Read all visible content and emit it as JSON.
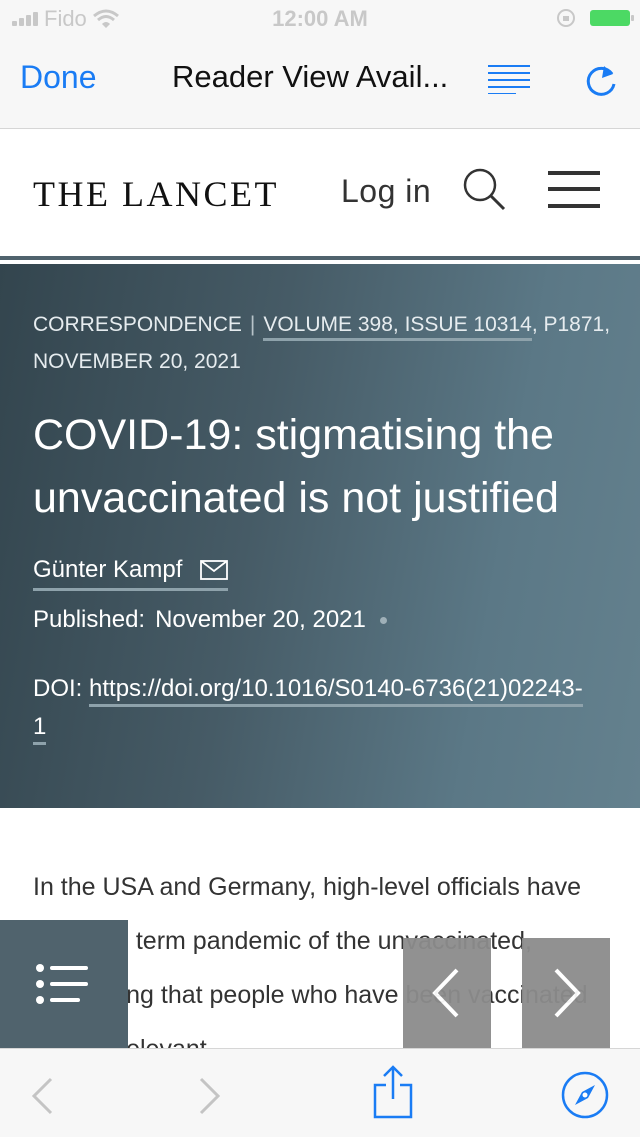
{
  "status_bar": {
    "carrier": "Fido",
    "time": "12:00 AM"
  },
  "safari": {
    "done_label": "Done",
    "title": "Reader View Avail..."
  },
  "site": {
    "logo": "THE LANCET",
    "login_label": "Log in"
  },
  "article": {
    "section": "CORRESPONDENCE",
    "volume_info": "VOLUME 398, ISSUE 10314",
    "page_date": ", P1871, NOVEMBER 20, 2021",
    "title": "COVID-19: stigmatising the unvaccinated is not justified",
    "author": "Günter Kampf",
    "published_label": "Published:",
    "published_date": "November 20, 2021",
    "doi_label": "DOI:",
    "doi_link": "https://doi.org/10.1016/S0140-6736(21)02243-1",
    "body_text": "In the USA and Germany, high-level officials have used the term pandemic of the unvaccinated, suggesting that people who have been vaccinated are not relevant"
  },
  "colors": {
    "ios_blue": "#1a7cf4",
    "banner_dark": "#33454e",
    "banner_light": "#64818e",
    "accent_slate": "#50636d",
    "nav_button_gray": "#8c8c8c",
    "battery_green": "#4cd964"
  },
  "icons": {
    "reader": "reader-view-icon",
    "reload": "reload-icon",
    "search": "search-icon",
    "menu": "hamburger-menu-icon",
    "email": "envelope-icon",
    "toc": "table-of-contents-icon",
    "prev": "chevron-left-icon",
    "next": "chevron-right-icon",
    "back": "back-arrow-icon",
    "forward": "forward-arrow-icon",
    "share": "share-icon",
    "compass": "compass-icon"
  }
}
